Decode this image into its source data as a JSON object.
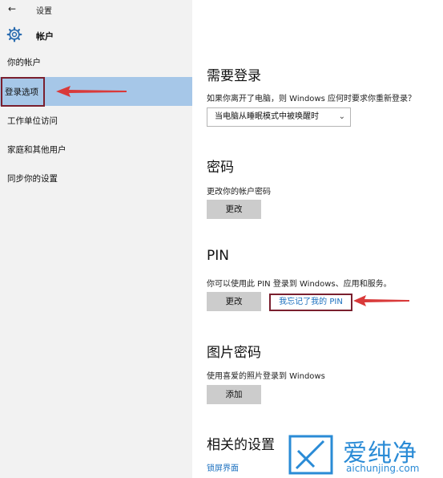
{
  "window": {
    "back_symbol": "←",
    "title": "设置"
  },
  "header": {
    "title": "帐户"
  },
  "sidebar": {
    "items": [
      {
        "label": "你的帐户"
      },
      {
        "label": "登录选项"
      },
      {
        "label": "工作单位访问"
      },
      {
        "label": "家庭和其他用户"
      },
      {
        "label": "同步你的设置"
      }
    ]
  },
  "signin": {
    "title": "需要登录",
    "description": "如果你离开了电脑，则 Windows 应何时要求你重新登录？",
    "dropdown_value": "当电脑从睡眠模式中被唤醒时"
  },
  "password": {
    "title": "密码",
    "description": "更改你的帐户密码",
    "change_label": "更改"
  },
  "pin": {
    "title": "PIN",
    "description": "你可以使用此 PIN 登录到 Windows、应用和服务。",
    "change_label": "更改",
    "forgot_link": "我忘记了我的 PIN"
  },
  "picture_password": {
    "title": "图片密码",
    "description": "使用喜爱的照片登录到 Windows",
    "add_label": "添加"
  },
  "related": {
    "title": "相关的设置",
    "lock_screen_link": "锁屏界面"
  },
  "watermark": {
    "title": "爱纯净",
    "url": "aichunjing.com"
  },
  "colors": {
    "accent": "#a6c7e8",
    "link": "#1a6fbf",
    "annotation": "#d93a3a"
  }
}
